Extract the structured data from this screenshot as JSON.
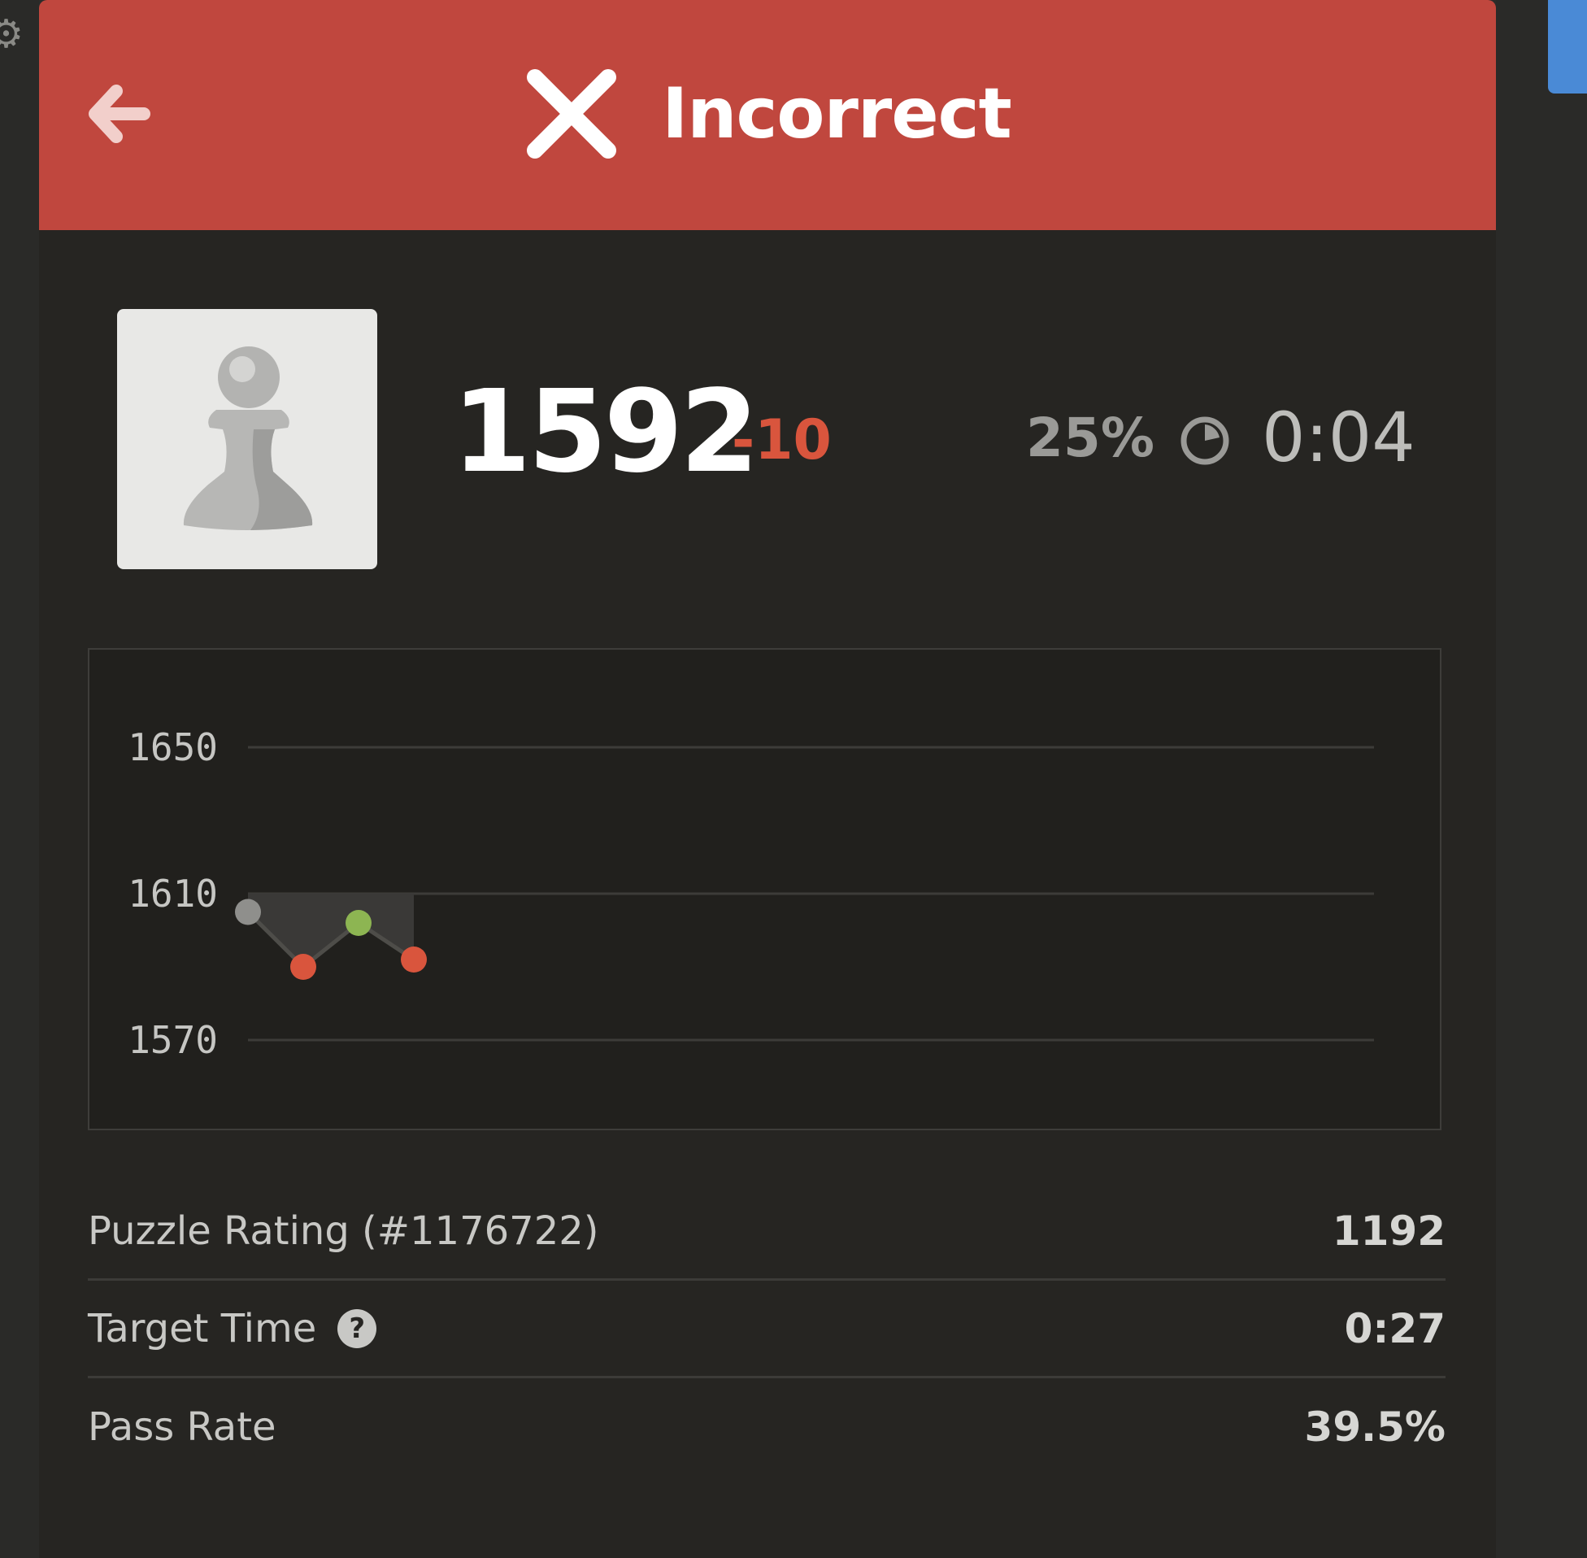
{
  "header": {
    "title": "Incorrect",
    "background_color": "#c0473e",
    "back_icon": "arrow-left-icon",
    "status_icon": "x-icon"
  },
  "player": {
    "avatar_icon": "pawn-icon",
    "rating": "1592",
    "rating_change": "-10",
    "rating_change_color": "#d9553d"
  },
  "attempt": {
    "percent": "25%",
    "timer_icon": "timer-icon",
    "elapsed": "0:04"
  },
  "chart_data": {
    "type": "line",
    "title": "",
    "xlabel": "",
    "ylabel": "",
    "ylim": [
      1560,
      1675
    ],
    "yticks": [
      1650,
      1610,
      1570
    ],
    "grid": true,
    "series": [
      {
        "x": [
          1,
          2,
          3,
          4
        ],
        "values": [
          1605,
          1590,
          1602,
          1592
        ],
        "point_colors": [
          "#8f8f8c",
          "#d9553d",
          "#8db552",
          "#d9553d"
        ]
      }
    ],
    "baseline": 1610
  },
  "info": {
    "rows": [
      {
        "label": "Puzzle Rating (#1176722)",
        "value": "1192"
      },
      {
        "label": "Target Time",
        "value": "0:27",
        "help_icon": "?"
      },
      {
        "label": "Pass Rate",
        "value": "39.5%"
      }
    ]
  }
}
